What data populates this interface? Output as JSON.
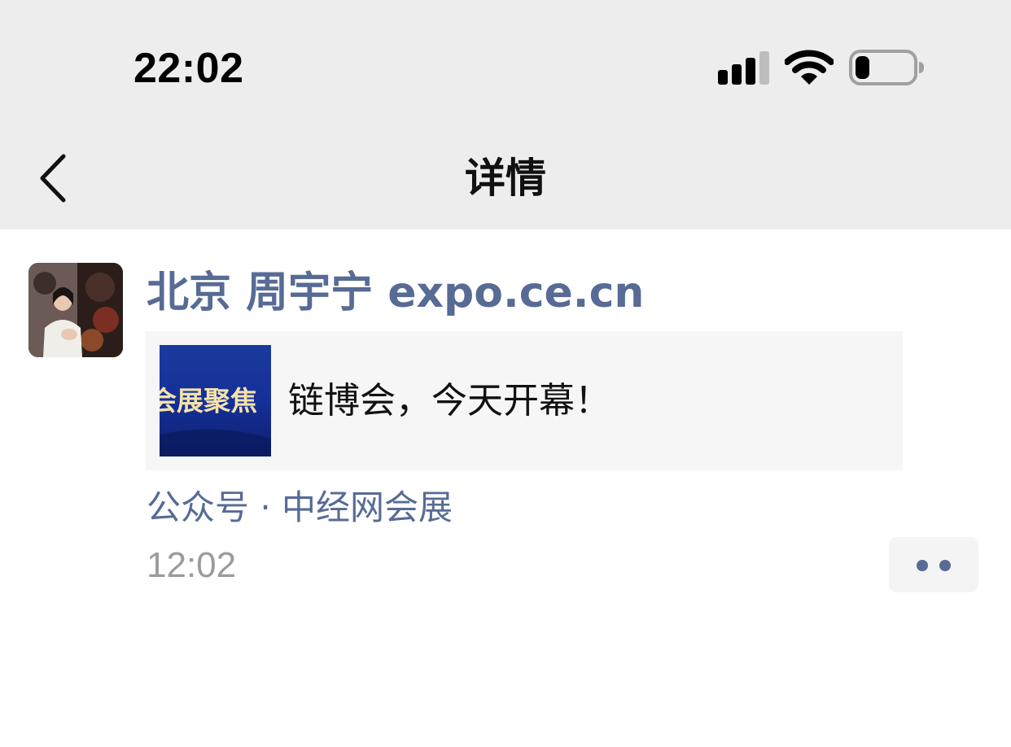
{
  "status_bar": {
    "time": "22:02",
    "signal_icon": "cellular-signal-icon",
    "wifi_icon": "wifi-icon",
    "battery_icon": "battery-icon",
    "battery_level": 0.25
  },
  "nav": {
    "back_icon": "chevron-left-icon",
    "title": "详情"
  },
  "post": {
    "author": "北京 周宇宁 expo.ce.cn",
    "card": {
      "thumb_text": "会展聚焦",
      "title": "链博会，今天开幕！"
    },
    "source": "公众号 · 中经网会展",
    "time": "12:02",
    "more_icon": "more-dots-icon"
  },
  "colors": {
    "header_bg": "#ededed",
    "link_blue": "#576b95",
    "card_bg": "#f6f6f6",
    "muted_gray": "#9b9b9b"
  }
}
